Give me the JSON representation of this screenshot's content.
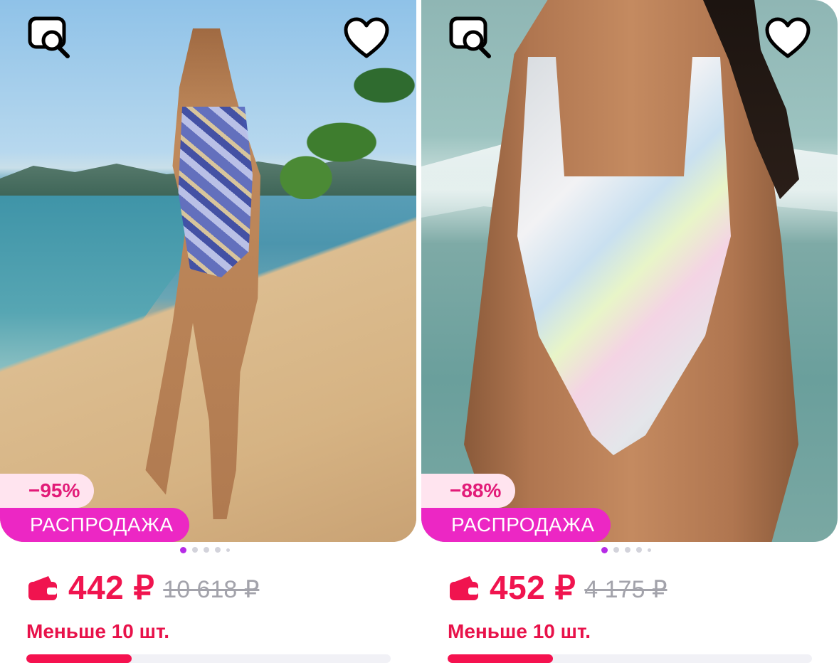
{
  "products": [
    {
      "discount": "−95%",
      "sale_label": "РАСПРОДАЖА",
      "price": "442 ₽",
      "old_price": "10 618 ₽",
      "stock_label": "Меньше 10 шт.",
      "stock_fraction": 0.29,
      "gallery_dots": 5,
      "gallery_active": 0,
      "icons": {
        "zoom": "image-search-icon",
        "favorite": "heart-outline-icon",
        "payment": "wallet-icon"
      }
    },
    {
      "discount": "−88%",
      "sale_label": "РАСПРОДАЖА",
      "price": "452 ₽",
      "old_price": "4 175 ₽",
      "stock_label": "Меньше 10 шт.",
      "stock_fraction": 0.29,
      "gallery_dots": 5,
      "gallery_active": 0,
      "icons": {
        "zoom": "image-search-icon",
        "favorite": "heart-outline-icon",
        "payment": "wallet-icon"
      }
    }
  ],
  "colors": {
    "price": "#f0144f",
    "sale_badge": "#ec27c4",
    "discount_badge_bg": "#ffe4ef",
    "discount_text": "#e21b78",
    "stock_fill": "#f5124f",
    "active_dot": "#b62be6"
  }
}
